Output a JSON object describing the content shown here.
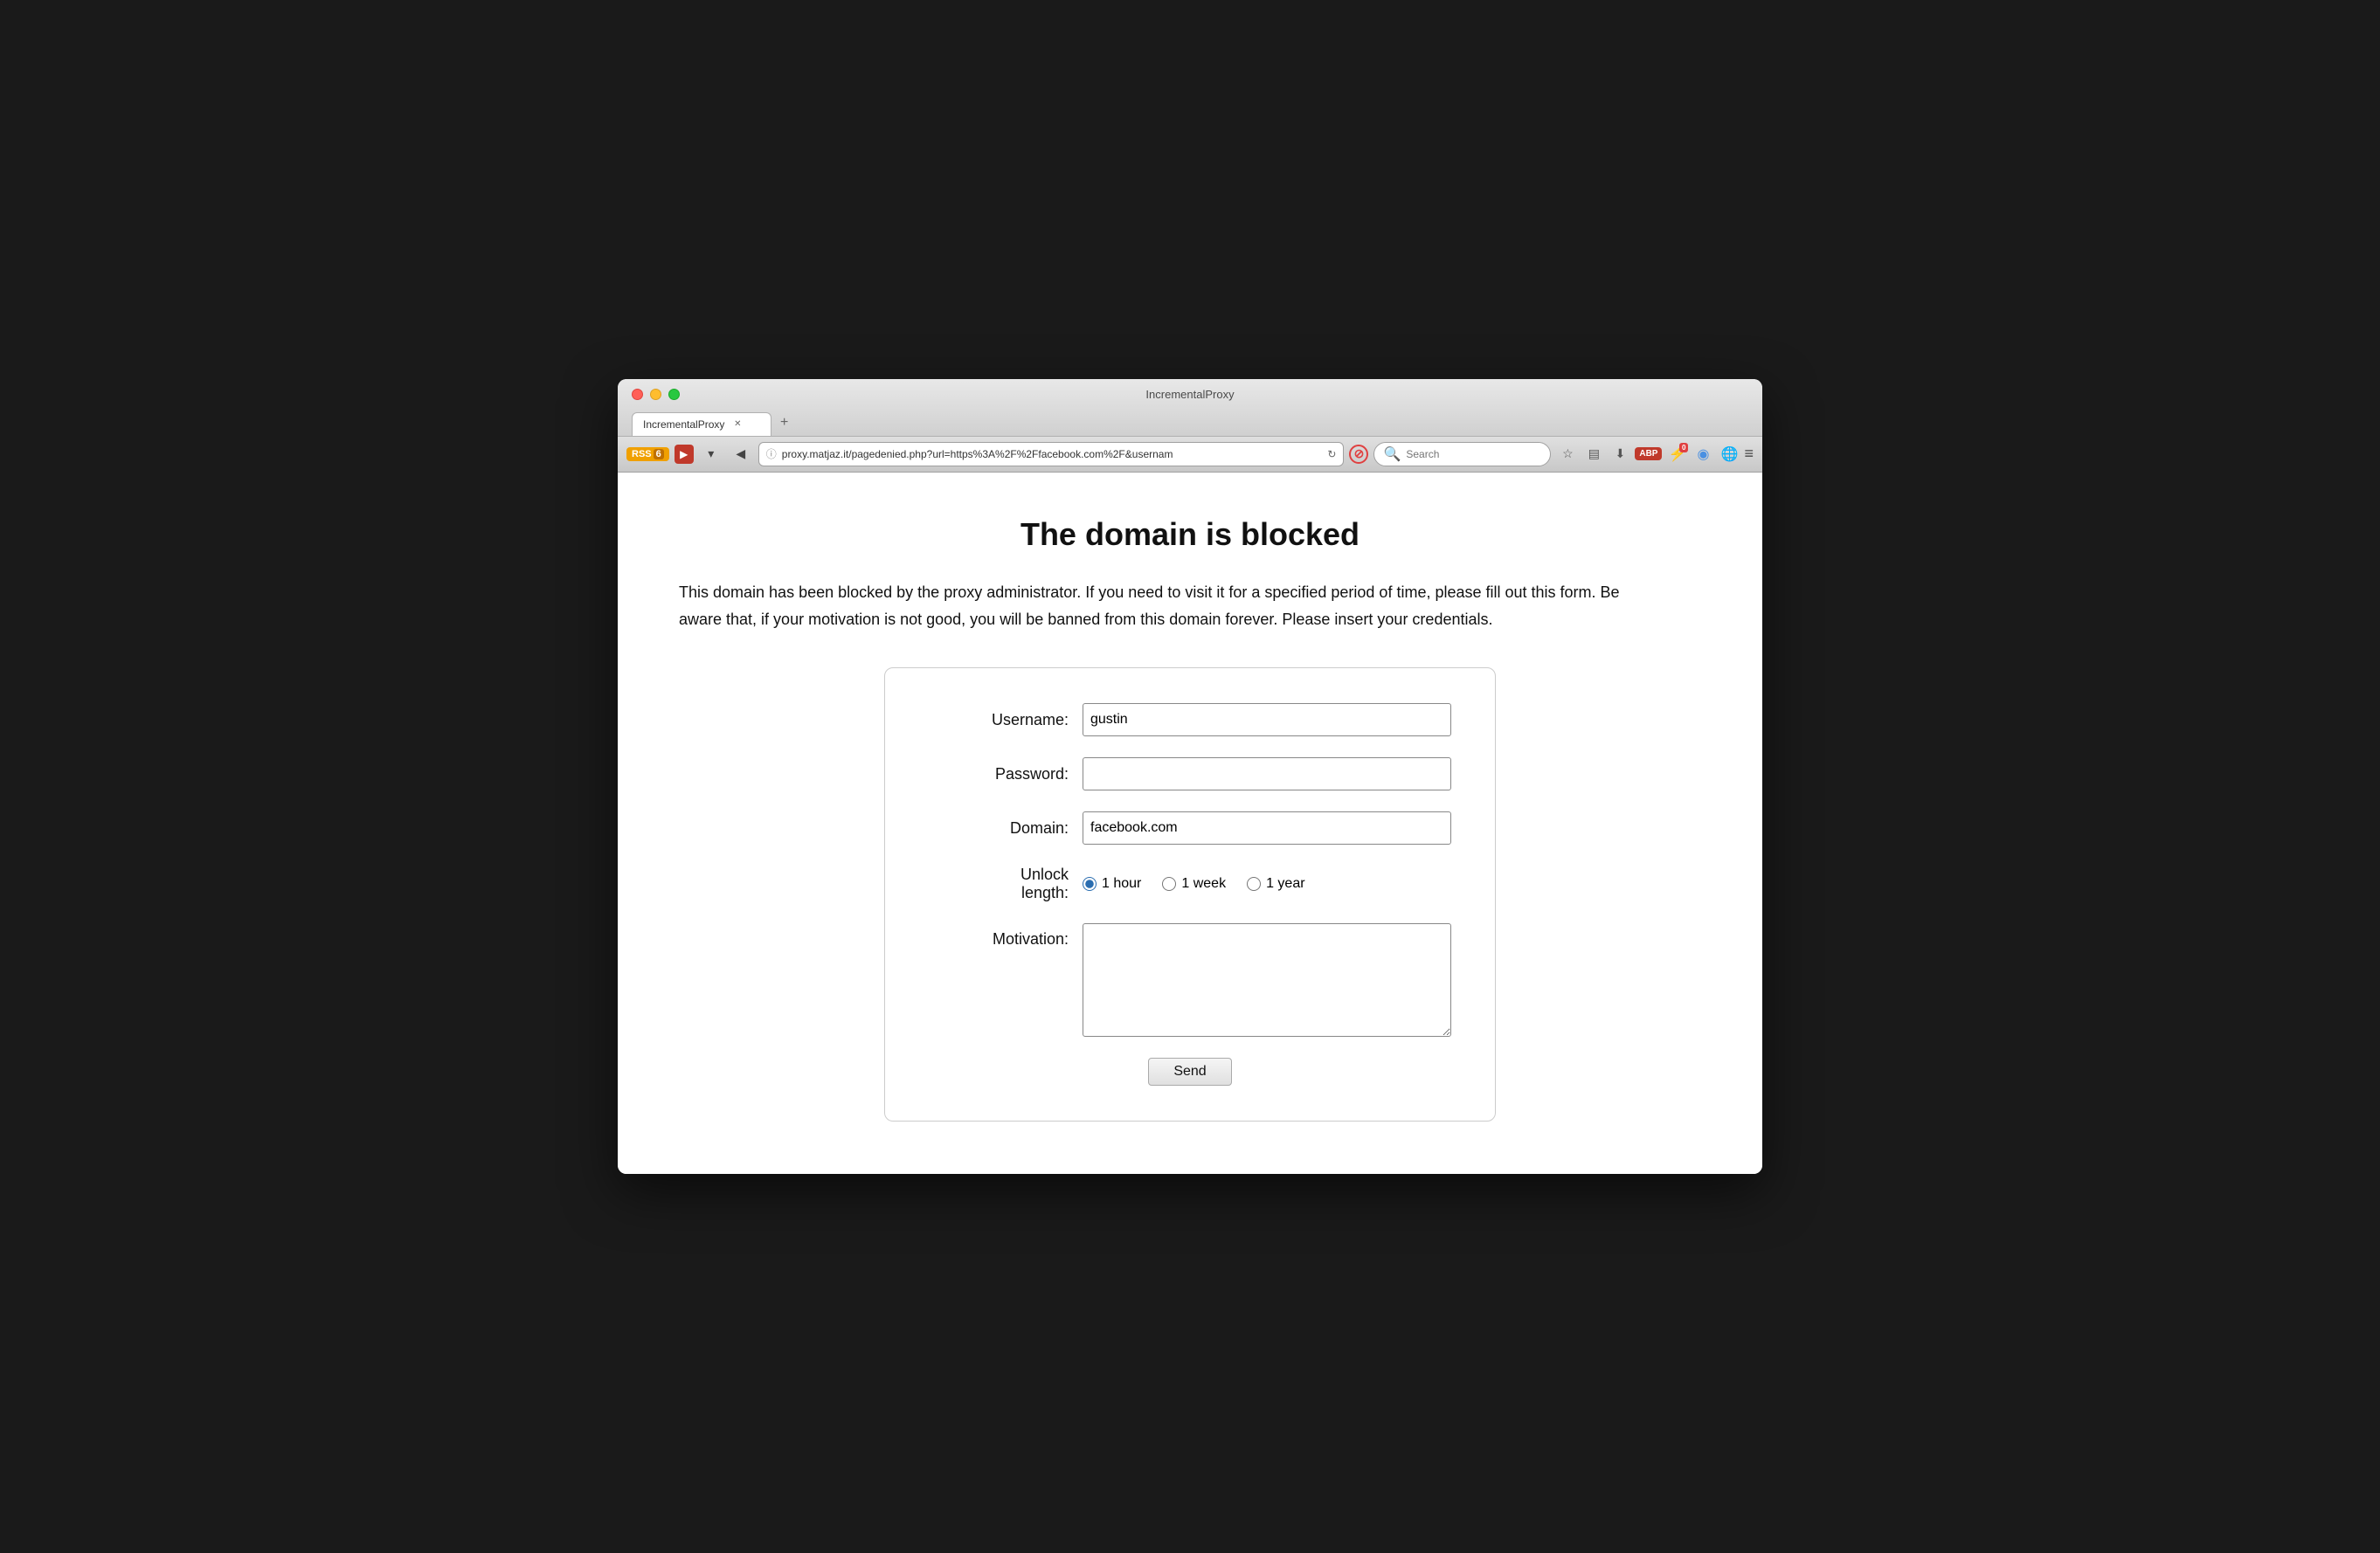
{
  "window": {
    "title": "IncrementalProxy"
  },
  "tabs": [
    {
      "label": "IncrementalProxy",
      "active": true
    },
    {
      "label": "+",
      "isNew": true
    }
  ],
  "navbar": {
    "rss_label": "RSS",
    "rss_count": "6",
    "url": "proxy.matjaz.it/pagedenied.php?url=https%3A%2F%2Ffacebook.com%2F&usernam",
    "search_placeholder": "Search"
  },
  "page": {
    "title": "The domain is blocked",
    "description": "This domain has been blocked by the proxy administrator. If you need to visit it for a specified period of time, please fill out this form. Be aware that, if your motivation is not good, you will be banned from this domain forever. Please insert your credentials.",
    "form": {
      "username_label": "Username:",
      "username_value": "gustin",
      "password_label": "Password:",
      "password_value": "",
      "domain_label": "Domain:",
      "domain_value": "facebook.com",
      "unlock_label": "Unlock\nlength:",
      "radio_options": [
        {
          "value": "1hour",
          "label": "1 hour",
          "checked": true
        },
        {
          "value": "1week",
          "label": "1 week",
          "checked": false
        },
        {
          "value": "1year",
          "label": "1 year",
          "checked": false
        }
      ],
      "motivation_label": "Motivation:",
      "motivation_value": "",
      "send_label": "Send"
    }
  }
}
